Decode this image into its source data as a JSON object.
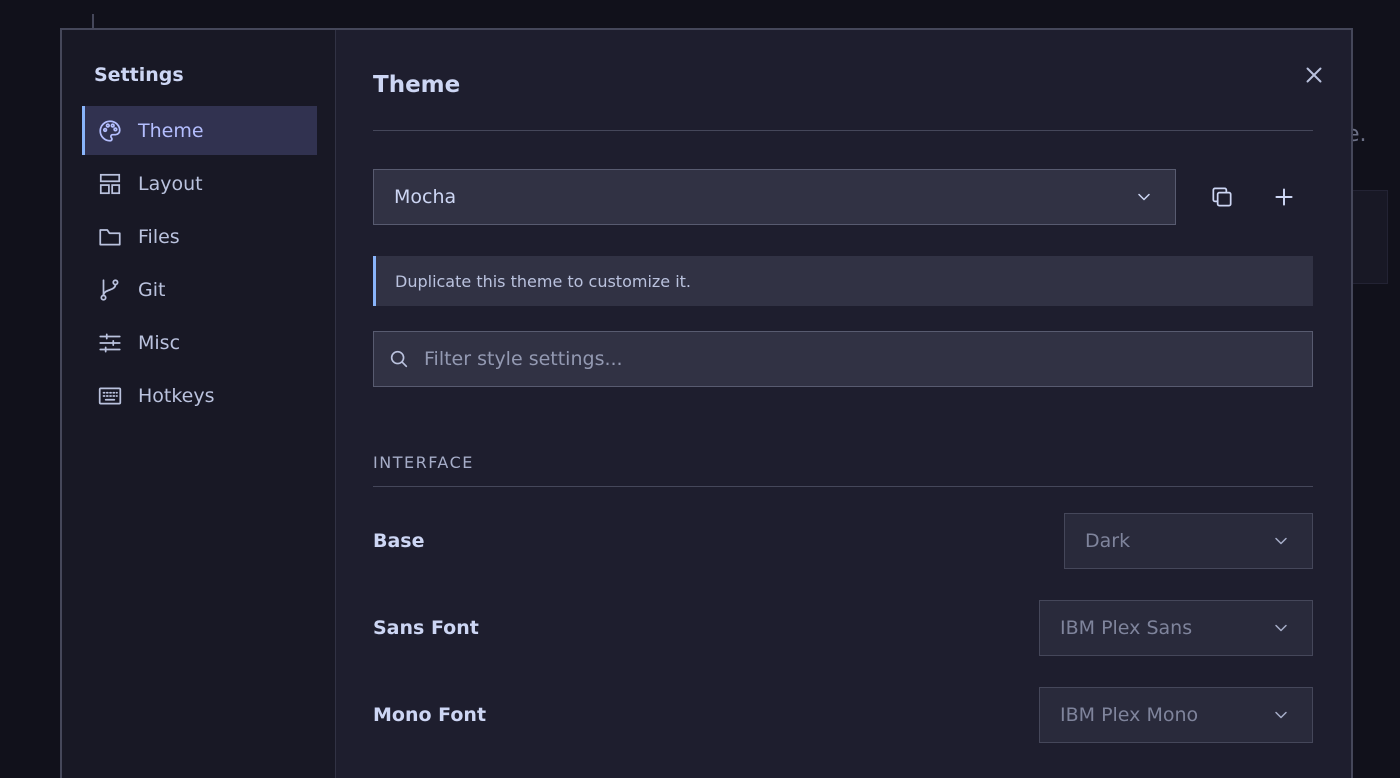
{
  "sidebar": {
    "title": "Settings",
    "items": [
      {
        "label": "Theme",
        "icon": "palette-icon",
        "active": true
      },
      {
        "label": "Layout",
        "icon": "layout-icon",
        "active": false
      },
      {
        "label": "Files",
        "icon": "folder-icon",
        "active": false
      },
      {
        "label": "Git",
        "icon": "git-branch-icon",
        "active": false
      },
      {
        "label": "Misc",
        "icon": "sliders-icon",
        "active": false
      },
      {
        "label": "Hotkeys",
        "icon": "keyboard-icon",
        "active": false
      }
    ]
  },
  "main": {
    "title": "Theme",
    "theme_select": {
      "value": "Mocha"
    },
    "notice": "Duplicate this theme to customize it.",
    "filter": {
      "placeholder": "Filter style settings...",
      "value": ""
    },
    "section": "INTERFACE",
    "settings": [
      {
        "label": "Base",
        "value": "Dark"
      },
      {
        "label": "Sans Font",
        "value": "IBM Plex Sans"
      },
      {
        "label": "Mono Font",
        "value": "IBM Plex Mono"
      }
    ]
  },
  "backdrop": {
    "text": "e."
  },
  "colors": {
    "background": "#11111b",
    "modal": "#1e1e2e",
    "sidebar": "#181825",
    "accent": "#89b4fa",
    "active_text": "#b4befe",
    "surface": "#313244",
    "text": "#cdd6f4"
  }
}
